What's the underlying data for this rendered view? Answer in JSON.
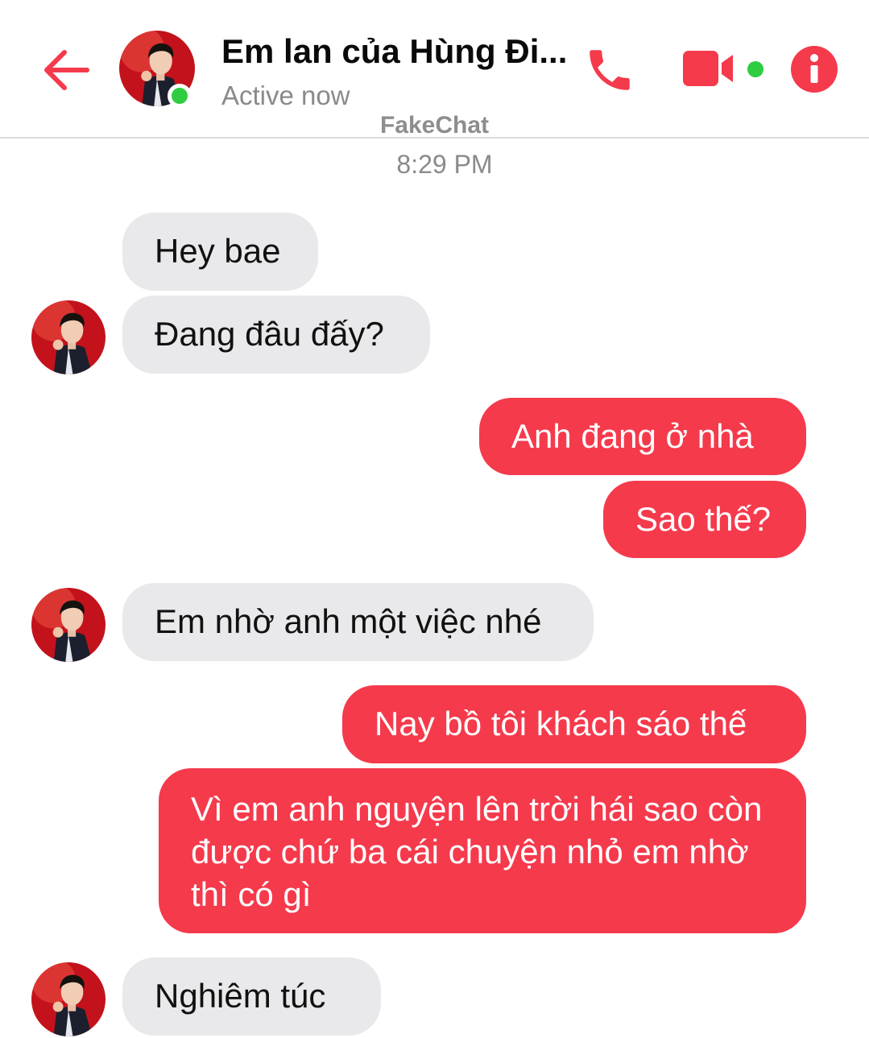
{
  "header": {
    "title": "Em lan của Hùng Đi...",
    "status": "Active now",
    "back_icon": "arrow-left-icon",
    "call_icon": "phone-icon",
    "video_icon": "video-camera-icon",
    "info_icon": "info-icon",
    "accent": "#f53a4c",
    "online_color": "#2ecc40"
  },
  "watermark": "FakeChat",
  "timestamp": "8:29 PM",
  "messages": [
    {
      "from": "them",
      "text": "Hey bae"
    },
    {
      "from": "them",
      "text": "Đang đâu đấy?"
    },
    {
      "from": "me",
      "text": "Anh đang ở nhà"
    },
    {
      "from": "me",
      "text": "Sao thế?"
    },
    {
      "from": "them",
      "text": "Em nhờ anh một việc nhé"
    },
    {
      "from": "me",
      "text": "Nay bồ tôi khách sáo thế"
    },
    {
      "from": "me",
      "text": "Vì em anh nguyện lên trời hái sao còn được chứ ba cái chuyện nhỏ em nhờ thì có gì"
    },
    {
      "from": "them",
      "text": "Nghiêm túc"
    }
  ]
}
